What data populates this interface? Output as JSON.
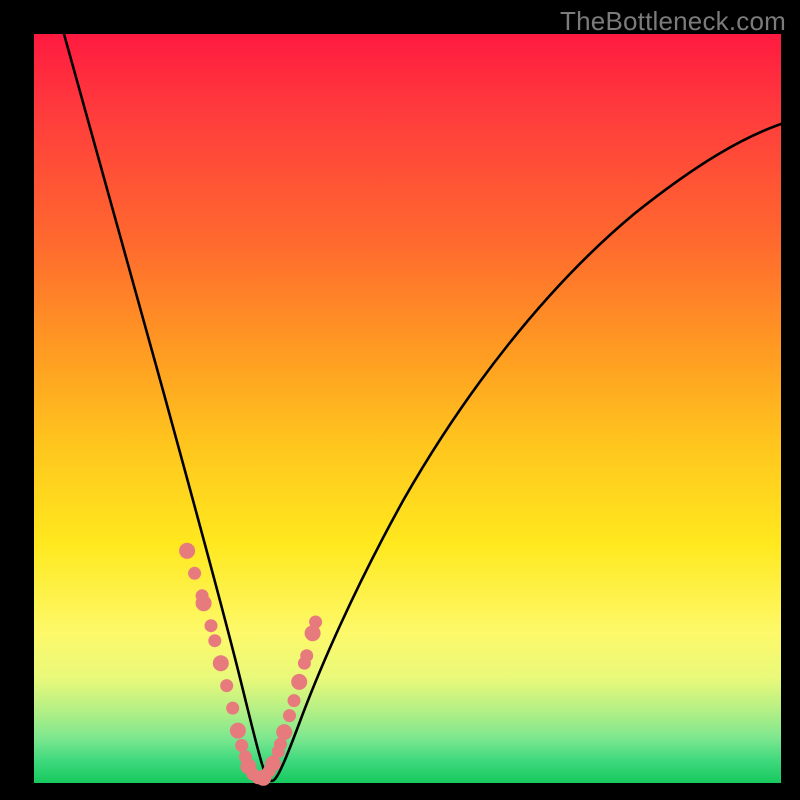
{
  "watermark": "TheBottleneck.com",
  "colors": {
    "frame": "#000000",
    "curve": "#000000",
    "dots": "#e77a7d",
    "gradient_stops": [
      "#ff1a40",
      "#ff6a2e",
      "#ffe81e",
      "#17c95e"
    ]
  },
  "chart_data": {
    "type": "line",
    "title": "",
    "xlabel": "",
    "ylabel": "",
    "xlim": [
      0,
      100
    ],
    "ylim": [
      0,
      100
    ],
    "note": "V-shaped bottleneck curve on heat gradient; no numeric tick labels visible. x/y are normalized percent of plot area (x right, y up from bottom).",
    "series": [
      {
        "name": "bottleneck-curve",
        "x": [
          4,
          6,
          8,
          10,
          12,
          14,
          16,
          18,
          20,
          22,
          24,
          26,
          27,
          28,
          29,
          30,
          31,
          33,
          35,
          38,
          42,
          48,
          55,
          63,
          72,
          82,
          92,
          100
        ],
        "y": [
          100,
          90,
          80,
          71,
          62,
          54,
          46,
          39,
          32,
          26,
          20,
          14,
          10,
          6,
          3,
          1,
          0.5,
          1,
          4,
          10,
          20,
          34,
          48,
          60,
          70,
          78,
          84,
          88
        ]
      }
    ],
    "scatter_points": {
      "name": "marked-points",
      "note": "salmon dots clustered on both limbs near the trough",
      "x": [
        20.5,
        21.5,
        22.5,
        22.7,
        23.7,
        24.2,
        25.0,
        25.8,
        26.6,
        27.3,
        27.8,
        28.3,
        28.7,
        29.3,
        30.0,
        30.7,
        31.0,
        31.5,
        32.0,
        32.7,
        33.0,
        33.5,
        34.2,
        34.8,
        35.5,
        36.2,
        36.5,
        37.3,
        37.7
      ],
      "y": [
        31,
        28,
        25,
        24,
        21,
        19,
        16,
        13,
        10,
        7,
        5,
        3.5,
        2.2,
        1.2,
        0.7,
        0.7,
        1.0,
        1.6,
        2.6,
        4.2,
        5.2,
        6.8,
        9.0,
        11,
        13.5,
        16,
        17,
        20,
        21.5
      ]
    }
  }
}
